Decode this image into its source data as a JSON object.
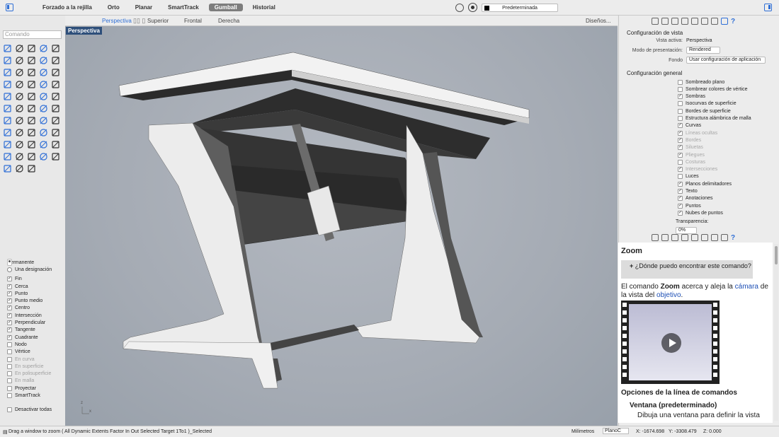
{
  "toolbar": {
    "modes": [
      "Forzado a la rejilla",
      "Orto",
      "Planar",
      "SmartTrack",
      "Gumball",
      "Historial"
    ],
    "active_mode": "Gumball",
    "layer": "Predeterminada"
  },
  "command": {
    "placeholder": "Comando"
  },
  "viewport_tabs": [
    "Perspectiva",
    "Superior",
    "Frontal",
    "Derecha"
  ],
  "active_viewport_tab": "Perspectiva",
  "layouts_label": "Diseños...",
  "viewport_label": "Perspectiva",
  "osnap": {
    "mode_permanent": "Permanente",
    "mode_once": "Una designación",
    "items": [
      {
        "label": "Fin",
        "checked": true,
        "enabled": true
      },
      {
        "label": "Cerca",
        "checked": true,
        "enabled": true
      },
      {
        "label": "Punto",
        "checked": true,
        "enabled": true
      },
      {
        "label": "Punto medio",
        "checked": true,
        "enabled": true
      },
      {
        "label": "Centro",
        "checked": true,
        "enabled": true
      },
      {
        "label": "Intersección",
        "checked": true,
        "enabled": true
      },
      {
        "label": "Perpendicular",
        "checked": true,
        "enabled": true
      },
      {
        "label": "Tangente",
        "checked": true,
        "enabled": true
      },
      {
        "label": "Cuadrante",
        "checked": true,
        "enabled": true
      },
      {
        "label": "Nodo",
        "checked": false,
        "enabled": true
      },
      {
        "label": "Vértice",
        "checked": false,
        "enabled": true
      },
      {
        "label": "En curva",
        "checked": false,
        "enabled": false
      },
      {
        "label": "En superficie",
        "checked": false,
        "enabled": false
      },
      {
        "label": "En polisuperficie",
        "checked": false,
        "enabled": false
      },
      {
        "label": "En malla",
        "checked": false,
        "enabled": false
      },
      {
        "label": "Proyectar",
        "checked": false,
        "enabled": true
      },
      {
        "label": "SmartTrack",
        "checked": false,
        "enabled": true
      }
    ],
    "disable_all": "Desactivar todas"
  },
  "display_panel": {
    "heading": "Configuración de vista",
    "active_view_label": "Vista activa:",
    "active_view_value": "Perspectiva",
    "display_mode_label": "Modo de presentación:",
    "display_mode_value": "Rendered",
    "background_label": "Fondo",
    "background_value": "Usar configuración de aplicación",
    "general_heading": "Configuración general",
    "options": [
      {
        "label": "Sombreado plano",
        "checked": false,
        "enabled": true
      },
      {
        "label": "Sombrear colores de vértice",
        "checked": false,
        "enabled": true
      },
      {
        "label": "Sombras",
        "checked": true,
        "enabled": true
      },
      {
        "label": "Isocurvas de superficie",
        "checked": false,
        "enabled": true
      },
      {
        "label": "Bordes de superficie",
        "checked": false,
        "enabled": true
      },
      {
        "label": "Estructura alámbrica de malla",
        "checked": false,
        "enabled": true
      },
      {
        "label": "Curvas",
        "checked": true,
        "enabled": true
      },
      {
        "label": "Líneas ocultas",
        "checked": true,
        "enabled": false
      },
      {
        "label": "Bordes",
        "checked": true,
        "enabled": false
      },
      {
        "label": "Siluetas",
        "checked": true,
        "enabled": false
      },
      {
        "label": "Pliegues",
        "checked": true,
        "enabled": false
      },
      {
        "label": "Costuras",
        "checked": false,
        "enabled": false
      },
      {
        "label": "Intersecciones",
        "checked": true,
        "enabled": false
      },
      {
        "label": "Luces",
        "checked": false,
        "enabled": true
      },
      {
        "label": "Planos delimitadores",
        "checked": true,
        "enabled": true
      },
      {
        "label": "Texto",
        "checked": true,
        "enabled": true
      },
      {
        "label": "Anotaciones",
        "checked": true,
        "enabled": true
      },
      {
        "label": "Puntos",
        "checked": true,
        "enabled": true
      },
      {
        "label": "Nubes de puntos",
        "checked": true,
        "enabled": true
      }
    ],
    "transparency_label": "Transparencia:",
    "transparency_value": "0%"
  },
  "help": {
    "title": "Zoom",
    "where_prefix": "+",
    "where_text": "¿Dónde puedo encontrar este comando?",
    "desc_a": "El comando ",
    "desc_cmd": "Zoom",
    "desc_b": " acerca y aleja la ",
    "desc_link1": "cámara",
    "desc_c": " de la vista del ",
    "desc_link2": "objetivo",
    "desc_d": ".",
    "options_heading": "Opciones de la línea de comandos",
    "option_name": "Ventana (predeterminado)",
    "option_desc": "Dibuja una ventana para definir la vista"
  },
  "status": {
    "prompt": "Drag a window to zoom ( All Dynamic Extents Factor In Out Selected Target 1To1 )_Selected",
    "units": "Milímetros",
    "cplane": "PlanoC",
    "x": "X: -1674.698",
    "y": "Y: -3308.479",
    "z": "Z: 0.000"
  },
  "colors": {
    "accent": "#2f6fd6",
    "viewport_label_bg": "#2e4f7a",
    "viewport_bg": "#a8aeb6"
  }
}
